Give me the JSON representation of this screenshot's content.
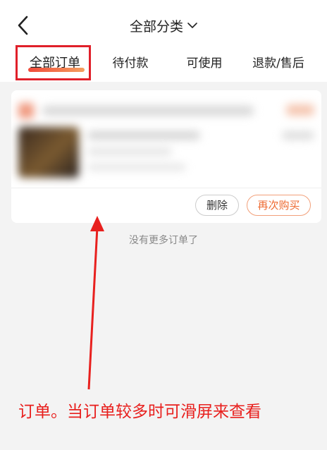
{
  "header": {
    "title": "全部分类",
    "back_icon": "chevron-left-icon",
    "title_dropdown_icon": "chevron-down-icon"
  },
  "tabs": [
    {
      "label": "全部订单",
      "active": true
    },
    {
      "label": "待付款",
      "active": false
    },
    {
      "label": "可使用",
      "active": false
    },
    {
      "label": "退款/售后",
      "active": false
    }
  ],
  "order": {
    "delete_label": "删除",
    "rebuy_label": "再次购买"
  },
  "list_end_text": "没有更多订单了",
  "annotation": {
    "text": "订单。当订单较多时可滑屏来查看",
    "color": "#e8201e"
  },
  "colors": {
    "accent": "#ee6a30",
    "highlight_box": "#e0202a",
    "tab_underline_start": "#f04a3a",
    "tab_underline_end": "#f4a060"
  }
}
